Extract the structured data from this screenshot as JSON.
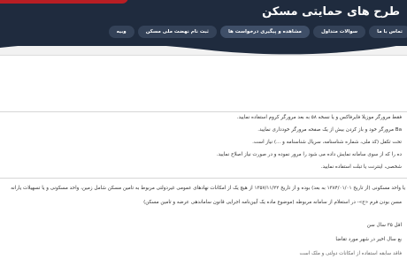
{
  "header": {
    "title": "طرح های حمایتی مسکن",
    "nav": [
      {
        "label": "وبیه"
      },
      {
        "label": "ثبت نام نهضت ملی مسکن"
      },
      {
        "label": "مشاهده و پیگیری درخواست ها"
      },
      {
        "label": "سوالات متداول"
      },
      {
        "label": "تماس با ما"
      }
    ]
  },
  "instructions": {
    "lines": [
      "فقط مرورگر موزیلا فایرفاکس و یا نسخه ۵۸ به بعد مرورگر کروم استفاده نمایید.",
      "Ba مرورگر خود و باز کردن بیش از یک صفحه مرورگر خودداری نمایید.",
      "تحت تکفل (کد ملی، شماره شناسنامه، سریال شناسنامه و ...) نیاز است.",
      "ده را که از سوی سامانه نمایش داده می شود را مرور نموده و در صورت نیاز اصلاح نمایید.",
      "شخصی، اینترنت یا تبلت استفاده نمایید."
    ]
  },
  "conditions": {
    "intro": "مسکونی یا واحد مسکونی (از تاریخ ۱۳۸۴/۰۱/۰۱ به بعد) بوده و از تاریخ ۱۳۵۷/۱۱/۲۲ از هیچ یک از امکانات نهادهای عمومی غیردولتی مربوط به تامین مسکن شامل زمین، واحد مسکونی و یا تسهیلات یارانه",
    "intro2": "مسن بودن فرم «ج»- در استعلام از سامانه مربوطه (موضوع ماده یک آیین‌نامه اجرایی قانون ساماندهی عرضه و تامین مسکن)",
    "items": [
      "اقل ۳۵ سال سن",
      "بع سال اخیر در شهر مورد تقاضا",
      "فاقد سابقه استفاده از امکانات دولتی و ملک است"
    ]
  }
}
